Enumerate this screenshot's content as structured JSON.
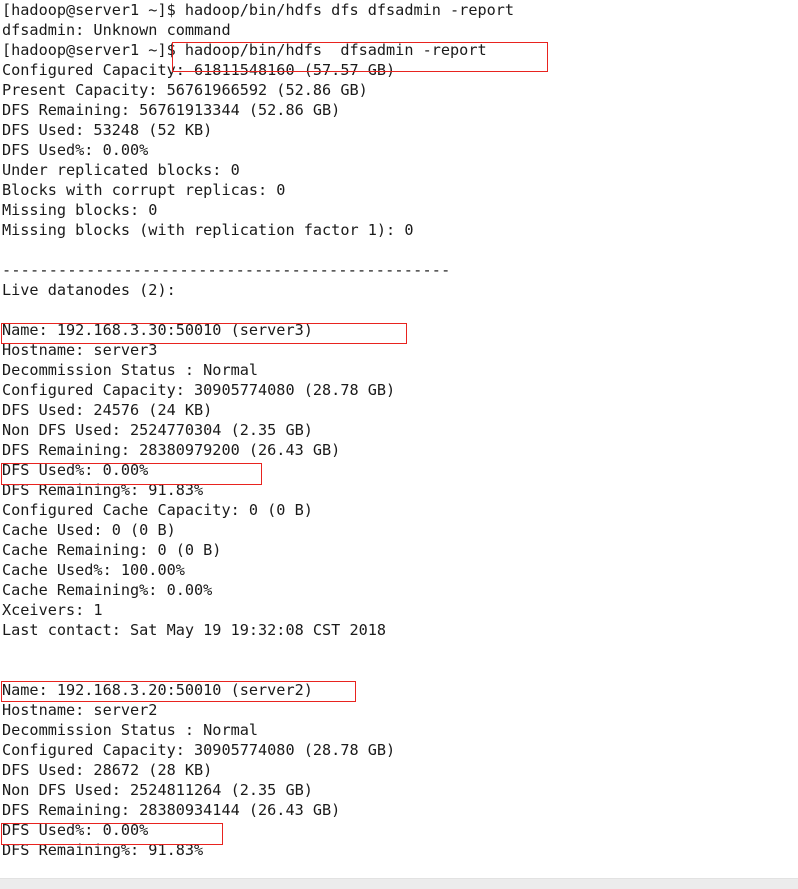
{
  "terminal": {
    "prompt": "[hadoop@server1 ~]$",
    "lines": [
      "[hadoop@server1 ~]$ hadoop/bin/hdfs dfs dfsadmin -report",
      "dfsadmin: Unknown command",
      "[hadoop@server1 ~]$ hadoop/bin/hdfs  dfsadmin -report",
      "Configured Capacity: 61811548160 (57.57 GB)",
      "Present Capacity: 56761966592 (52.86 GB)",
      "DFS Remaining: 56761913344 (52.86 GB)",
      "DFS Used: 53248 (52 KB)",
      "DFS Used%: 0.00%",
      "Under replicated blocks: 0",
      "Blocks with corrupt replicas: 0",
      "Missing blocks: 0",
      "Missing blocks (with replication factor 1): 0",
      "",
      "------------------------------------------------",
      "Live datanodes (2):",
      "",
      "Name: 192.168.3.30:50010 (server3)",
      "Hostname: server3",
      "Decommission Status : Normal",
      "Configured Capacity: 30905774080 (28.78 GB)",
      "DFS Used: 24576 (24 KB)",
      "Non DFS Used: 2524770304 (2.35 GB)",
      "DFS Remaining: 28380979200 (26.43 GB)",
      "DFS Used%: 0.00%",
      "DFS Remaining%: 91.83%",
      "Configured Cache Capacity: 0 (0 B)",
      "Cache Used: 0 (0 B)",
      "Cache Remaining: 0 (0 B)",
      "Cache Used%: 100.00%",
      "Cache Remaining%: 0.00%",
      "Xceivers: 1",
      "Last contact: Sat May 19 19:32:08 CST 2018",
      "",
      "",
      "Name: 192.168.3.20:50010 (server2)",
      "Hostname: server2",
      "Decommission Status : Normal",
      "Configured Capacity: 30905774080 (28.78 GB)",
      "DFS Used: 28672 (28 KB)",
      "Non DFS Used: 2524811264 (2.35 GB)",
      "DFS Remaining: 28380934144 (26.43 GB)",
      "DFS Used%: 0.00%",
      "DFS Remaining%: 91.83%"
    ]
  },
  "report": {
    "failed_command": "hadoop/bin/hdfs dfs dfsadmin -report",
    "error_message": "dfsadmin: Unknown command",
    "command": "hadoop/bin/hdfs  dfsadmin -report",
    "cluster": {
      "configured_capacity": "61811548160 (57.57 GB)",
      "present_capacity": "56761966592 (52.86 GB)",
      "dfs_remaining": "56761913344 (52.86 GB)",
      "dfs_used": "53248 (52 KB)",
      "dfs_used_pct": "0.00%",
      "under_replicated_blocks": "0",
      "blocks_with_corrupt_replicas": "0",
      "missing_blocks": "0",
      "missing_blocks_rf1": "0",
      "live_datanodes": "Live datanodes (2):",
      "live_datanodes_count": 2
    },
    "datanodes": [
      {
        "name": "192.168.3.30:50010 (server3)",
        "hostname": "server3",
        "decommission_status": "Normal",
        "configured_capacity": "30905774080 (28.78 GB)",
        "dfs_used": "24576 (24 KB)",
        "non_dfs_used": "2524770304 (2.35 GB)",
        "dfs_remaining": "28380979200 (26.43 GB)",
        "dfs_used_pct": "0.00%",
        "dfs_remaining_pct": "91.83%",
        "configured_cache_capacity": "0 (0 B)",
        "cache_used": "0 (0 B)",
        "cache_remaining": "0 (0 B)",
        "cache_used_pct": "100.00%",
        "cache_remaining_pct": "0.00%",
        "xceivers": "1",
        "last_contact": "Sat May 19 19:32:08 CST 2018"
      },
      {
        "name": "192.168.3.20:50010 (server2)",
        "hostname": "server2",
        "decommission_status": "Normal",
        "configured_capacity": "30905774080 (28.78 GB)",
        "dfs_used": "28672 (28 KB)",
        "non_dfs_used": "2524811264 (2.35 GB)",
        "dfs_remaining": "28380934144 (26.43 GB)",
        "dfs_used_pct": "0.00%",
        "dfs_remaining_pct": "91.83%"
      }
    ]
  },
  "annotations": {
    "accent_color": "#e8231f",
    "boxes": [
      "hadoop/bin/hdfs  dfsadmin -report",
      "Name: 192.168.3.30:50010 (server3)",
      "DFS Used%: 0.00%",
      "Name: 192.168.3.20:50010 (server2)",
      "DFS Used%: 0.00%"
    ]
  }
}
